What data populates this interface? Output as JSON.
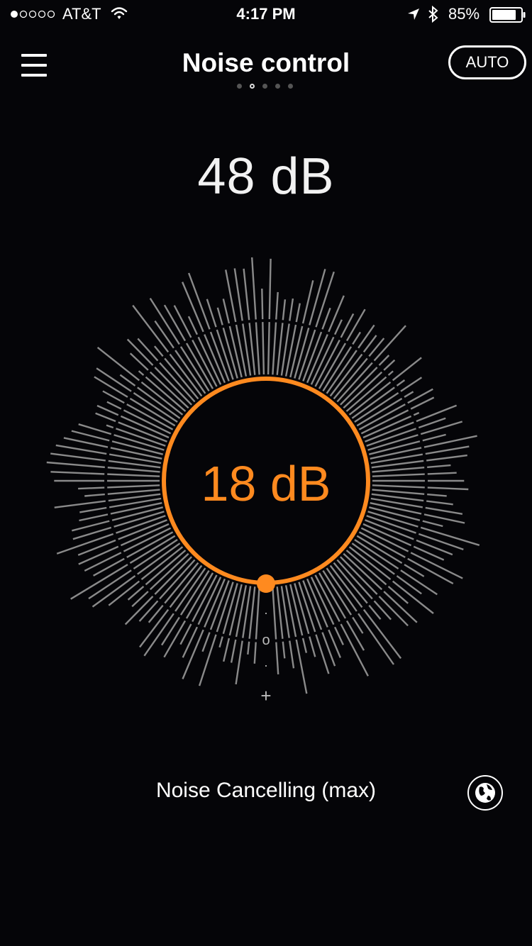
{
  "status_bar": {
    "carrier": "AT&T",
    "time": "4:17 PM",
    "battery_percent": "85%",
    "signal_bars": 1,
    "signal_total": 5,
    "icons": [
      "signal-dots-icon",
      "wifi-icon",
      "location-arrow-icon",
      "bluetooth-icon",
      "battery-icon"
    ]
  },
  "nav": {
    "title": "Noise control",
    "auto_label": "AUTO",
    "menu_icon": "hamburger-menu-icon"
  },
  "pager": {
    "count": 5,
    "active_index": 1
  },
  "ambient_db": "48 dB",
  "dial": {
    "center_db": "18 dB",
    "accent_color": "#ff8a1f",
    "spike_color": "#8a8a8a",
    "minus_glyph": "·",
    "zero_glyph": "o",
    "plus_glyph": "+",
    "handle_icon": "slider-handle-icon"
  },
  "mode_label": "Noise Cancelling (max)",
  "globe_icon": "globe-icon"
}
